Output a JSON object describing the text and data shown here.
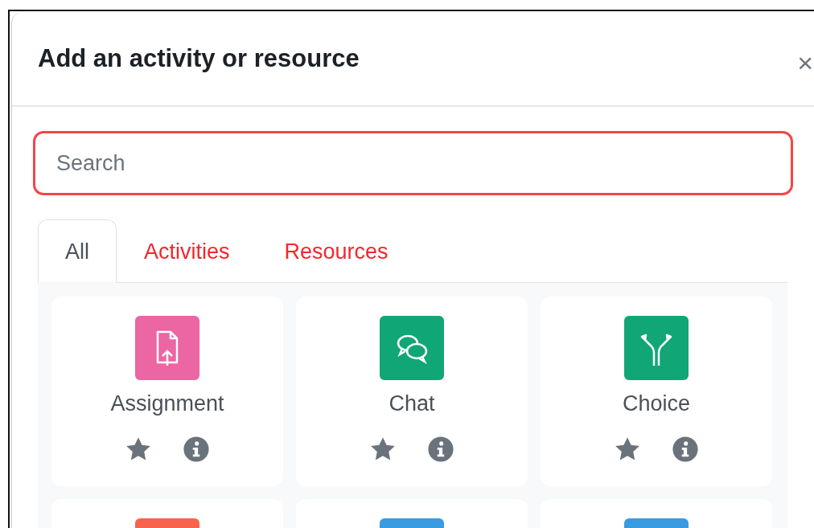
{
  "dialog": {
    "title": "Add an activity or resource",
    "close": "×"
  },
  "search": {
    "placeholder": "Search"
  },
  "tabs": [
    {
      "label": "All",
      "selected": true
    },
    {
      "label": "Activities",
      "selected": false
    },
    {
      "label": "Resources",
      "selected": false
    }
  ],
  "items": [
    {
      "name": "Assignment",
      "color": "#eb66a2",
      "kind": "assignment",
      "starred": false
    },
    {
      "name": "Chat",
      "color": "#11a676",
      "kind": "chat",
      "starred": false
    },
    {
      "name": "Choice",
      "color": "#11a676",
      "kind": "choice",
      "starred": false
    },
    {
      "color": "#f7634d",
      "kind": "blank"
    },
    {
      "color": "#399be2",
      "kind": "blank"
    },
    {
      "color": "#399be2",
      "kind": "blank"
    }
  ]
}
